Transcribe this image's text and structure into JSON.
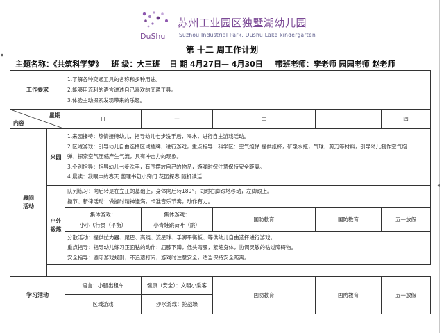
{
  "logo": {
    "mark_text": "DuShu",
    "name_cn": "苏州工业园区独墅湖幼儿园",
    "name_en": "Suzhou Industrial Park, Dushu Lake kindergarten"
  },
  "doc_title": "第 十二 周工作计划",
  "header": {
    "theme": "主题名称：《共筑科学梦》",
    "class": "班  级：大三班",
    "date": "日  期  4月27日— 4月30日",
    "teachers": "带班老师：李老师  园园老师 赵老师"
  },
  "requirements": {
    "label": "工作要求",
    "items": [
      "1.了解各种交通工具的名称和多种用途。",
      "2.能够用流利的语言讲述自己喜欢的交通工具。",
      "3.体验主动探索发现带来的乐趣。"
    ]
  },
  "weekday_row": {
    "top_label": "星期",
    "bottom_label": "内容",
    "days": [
      "日",
      "一",
      "二",
      "三",
      "四"
    ]
  },
  "morning": {
    "label_lines": [
      "晨间",
      "活动"
    ],
    "arrival": {
      "label": "来园",
      "items": [
        "1.来园接待：热情接待幼儿，指导幼儿七步洗手后，喝水，进行自主游戏活动。",
        "2.区域游戏：引导幼儿自由选择区域插牌，进行游戏，重点指导：科学区：空气炮弹:提供纸杯，矿泉水瓶，气球，剪刀等材料，引导幼儿制作空气炮",
        "弹，探索空气压缩产生气流，具有冲击力的现象。",
        "3.个别指导：指导幼儿七步洗手，有序摆放自己的物品，游戏时保注意保持安全距离。",
        "4.晨读：我眼中的春天  整理书包小窍门  花园探春   随机读活"
      ]
    },
    "outdoor": {
      "label_lines": [
        "户外",
        "锻炼"
      ],
      "queue": "队列练习：向后转是在立正的基础上，身体向后转180°，同时右脚跟地移动，左脚跟上。",
      "exercise": "操节、新律活动：做操时精神饱满，卡准音乐节奏，动作有力。",
      "group_title": "集体游戏：",
      "game_sun": "小小飞行员（平衡）",
      "game_mon": "小青蛙跳荷叶（跳）",
      "cols": [
        "国防教育",
        "国防教育",
        "五一放假"
      ],
      "scatter": "分散活动：提供拉力器、尾巴、高跷、流星球、手脚平衡板、等供幼儿自由选择进行游戏。",
      "key_point": "重点指导：指导幼儿练习正面钻的动作：屈膝下蹲，低头弯腰，紧缩身体，协调灵敏的钻过障碍物。",
      "safety": "安全指导：遵守游戏规则，不追逐打闹，游戏时注意安全，适当保持安全距离。"
    }
  },
  "study": {
    "label": "学习活动",
    "row1": [
      "语言：小腿出租车",
      "健康（安全）：文明小乘客",
      "国防教育",
      "国防教育",
      "五一放假"
    ],
    "row2": [
      "区域游戏",
      "沙水游戏：挖战壕"
    ]
  }
}
